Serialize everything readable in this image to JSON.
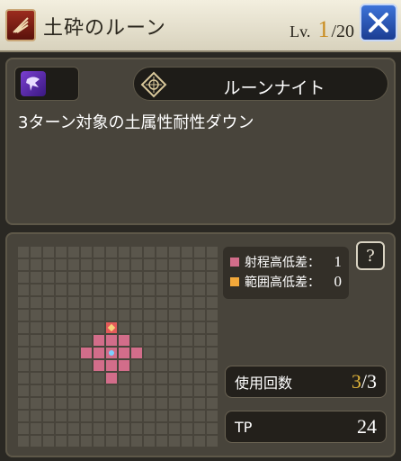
{
  "header": {
    "title": "土砕のルーン",
    "level_prefix": "Lv.",
    "level_current": "1",
    "level_max": "/20",
    "close_icon": "close-icon"
  },
  "skill": {
    "attribute_icon": "earth-attribute-icon",
    "class_icon": "class-emblem-icon",
    "class_name": "ルーンナイト",
    "description": "3ターン対象の土属性耐性ダウン"
  },
  "range": {
    "legend": [
      {
        "label": "射程高低差：",
        "value": "1",
        "color": "#d26d8a"
      },
      {
        "label": "範囲高低差：",
        "value": "0",
        "color": "#f2a83a"
      }
    ],
    "help_label": "?"
  },
  "stats": {
    "uses_label": "使用回数",
    "uses_current": "3",
    "uses_max": "/3",
    "tp_label": "TP",
    "tp_value": "24"
  }
}
